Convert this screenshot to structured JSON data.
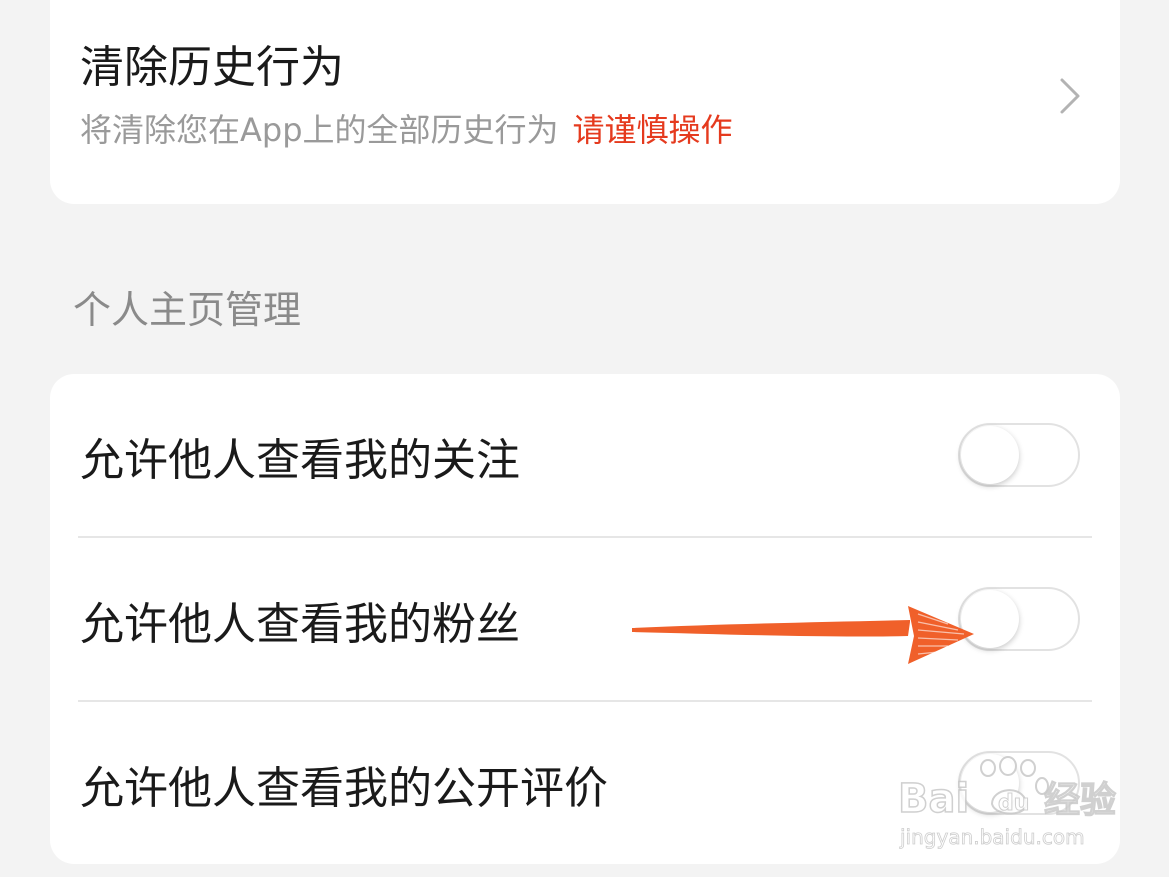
{
  "history_card": {
    "title": "清除历史行为",
    "description": "将清除您在App上的全部历史行为",
    "warning": "请谨慎操作",
    "warning_color": "#e53a1e",
    "chevron_icon": "chevron-right-icon"
  },
  "profile_section": {
    "label": "个人主页管理",
    "toggles": [
      {
        "label": "允许他人查看我的关注",
        "on": false
      },
      {
        "label": "允许他人查看我的粉丝",
        "on": false
      },
      {
        "label": "允许他人查看我的公开评价",
        "on": false
      }
    ]
  },
  "annotation": {
    "arrow_color": "#f0602a",
    "arrow_icon": "red-arrow-annotation"
  },
  "watermark": {
    "brand_text": "Bai 经验",
    "brand_url_text": "jingyan.baidu.com",
    "icon": "baidu-paw-logo"
  }
}
